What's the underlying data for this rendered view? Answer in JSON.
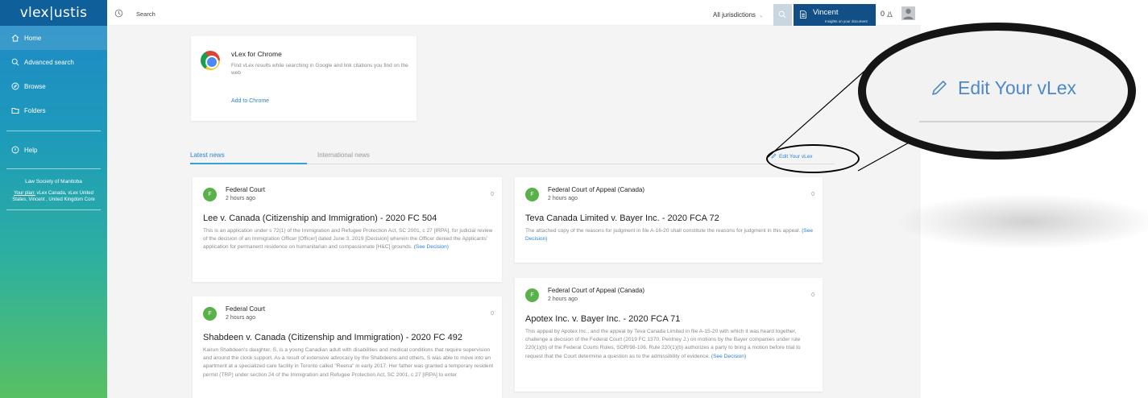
{
  "sidebar": {
    "logo": "vlex|ustis",
    "items": [
      {
        "label": "Home",
        "icon": "home-icon"
      },
      {
        "label": "Advanced search",
        "icon": "search-icon"
      },
      {
        "label": "Browse",
        "icon": "compass-icon"
      },
      {
        "label": "Folders",
        "icon": "folder-icon"
      },
      {
        "label": "Help",
        "icon": "help-icon"
      }
    ],
    "organization": "Law Society of Manitoba",
    "plan_label": "Your plan:",
    "plan_text": "vLex Canada, vLex United States, Vincent , United Kingdom Core",
    "colors": {
      "logo_bar": "#0f5f9b",
      "gradient_top": "#1f86c8",
      "gradient_bottom": "#58c063"
    }
  },
  "topbar": {
    "search_placeholder": "Search",
    "jurisdictions": "All jurisdictions",
    "vincent_title": "Vincent",
    "vincent_sub": "Insights on your document",
    "counter": "0",
    "colors": {
      "vincent_bg": "#124f87",
      "search_btn": "#c9d6df"
    }
  },
  "chrome_card": {
    "title": "vLex for Chrome",
    "description": "Find vLex results while searching in Google and link citations you find on the web",
    "link": "Add to Chrome"
  },
  "tabs": {
    "latest": "Latest news",
    "international": "International news",
    "edit": "Edit Your vLex"
  },
  "news": [
    {
      "avatar": "F",
      "court": "Federal Court",
      "time": "2 hours ago",
      "count": "0",
      "title": "Lee v. Canada (Citizenship and Immigration) - 2020 FC 504",
      "body": "This is an application under s 72(1) of the Immigration and Refugee Protection Act, SC 2001, c 27 [IRPA], for judicial review of the decision of an Immigration Officer [Officer] dated June 3, 2019 [Decision] wherein the Officer denied the Applicants' application for permanent residence on humanitarian and compassionate [H&C] grounds.",
      "see": "(See Decision)"
    },
    {
      "avatar": "F",
      "court": "Federal Court of Appeal (Canada)",
      "time": "2 hours ago",
      "count": "0",
      "title": "Teva Canada Limited v. Bayer Inc. - 2020 FCA 72",
      "body": "The attached copy of the reasons for judgment in file A-16-20 shall constitute the reasons for judgment in this appeal.",
      "see": "(See Decision)"
    },
    {
      "avatar": "F",
      "court": "Federal Court",
      "time": "2 hours ago",
      "count": "0",
      "title": "Shabdeen v. Canada (Citizenship and Immigration) - 2020 FC 492",
      "body": "Kairun Shabdeen's daughter, S, is a young Canadian adult with disabilities and medical conditions that require supervision and around the clock support. As a result of extensive advocacy by the Shabdeens and others, S was able to move into an apartment at a specialized care facility in Toronto called \"Reena\" in early 2017. Her father was granted a temporary resident permit (TRP) under section 24 of the Immigration and Refugee Protection Act, SC 2001, c 27 [IRPA] to enter",
      "see": ""
    },
    {
      "avatar": "F",
      "court": "Federal Court of Appeal (Canada)",
      "time": "2 hours ago",
      "count": "0",
      "title": "Apotex Inc. v. Bayer Inc. - 2020 FCA 71",
      "body": "This appeal by Apotex Inc., and the appeal by Teva Canada Limited in file A-15-20 with which it was heard together, challenge a decision of the Federal Court (2019 FC 1370, Pentney J.) on motions by the Bayer companies under rule 220(1)(b) of the Federal Courts Rules, SOR/98-106. Rule 220(1)(b) authorizes a party to bring a motion before trial to request that the Court determine a question as to the admissibility of evidence.",
      "see": "(See Decision)"
    }
  ],
  "zoom_callout": {
    "label": "Edit Your vLex"
  }
}
